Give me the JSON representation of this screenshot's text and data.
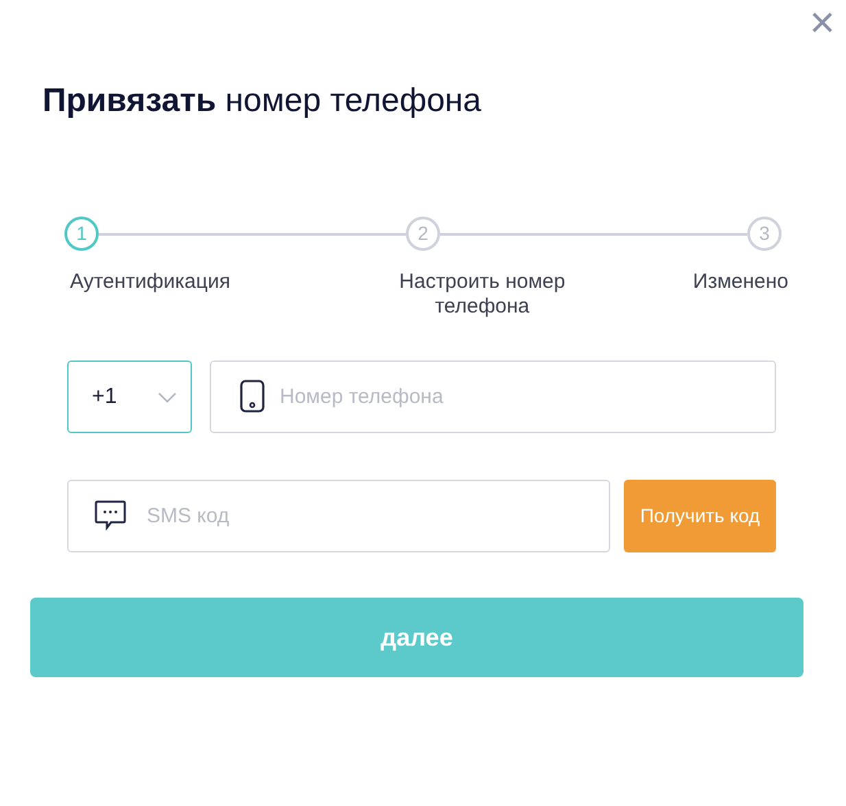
{
  "close_label": "×",
  "title": "**Привязать** номер телефона",
  "steps": [
    {
      "number": "1",
      "label": "Аутентификация",
      "selected": true
    },
    {
      "number": "2",
      "label": "Настроить номер телефона",
      "selected": false
    },
    {
      "number": "3",
      "label": "Изменено",
      "selected": false
    }
  ],
  "country_code": {
    "value": "+1"
  },
  "phone": {
    "placeholder": "Номер телефона"
  },
  "sms": {
    "placeholder": "SMS код"
  },
  "get_code_button": "Получить код",
  "next_button": "далее"
}
